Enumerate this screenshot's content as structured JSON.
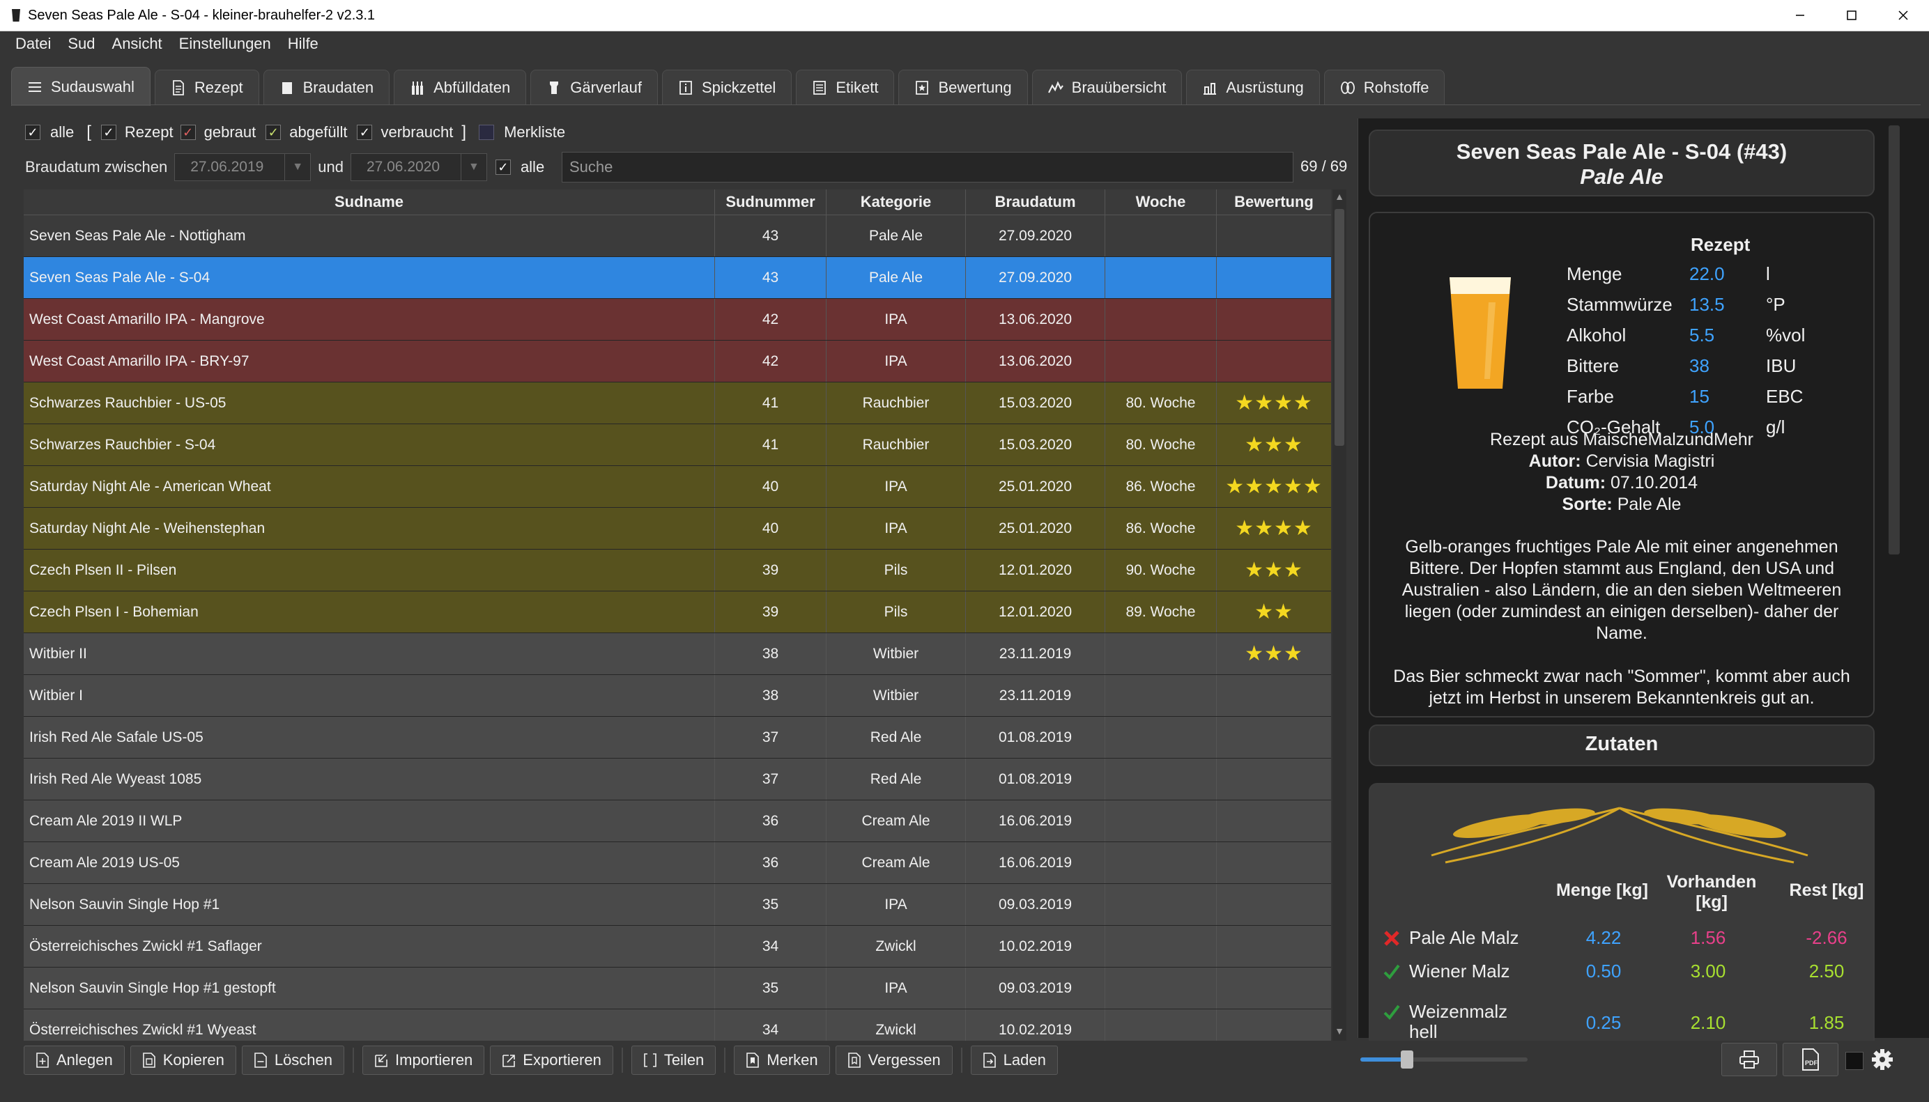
{
  "window": {
    "title": "Seven Seas Pale Ale - S-04 - kleiner-brauhelfer-2 v2.3.1"
  },
  "menu": [
    "Datei",
    "Sud",
    "Ansicht",
    "Einstellungen",
    "Hilfe"
  ],
  "tabs": [
    {
      "label": "Sudauswahl",
      "icon": "list-icon",
      "active": true
    },
    {
      "label": "Rezept",
      "icon": "document-icon"
    },
    {
      "label": "Braudaten",
      "icon": "kettle-icon"
    },
    {
      "label": "Abfülldaten",
      "icon": "bottles-icon"
    },
    {
      "label": "Gärverlauf",
      "icon": "fermenter-icon"
    },
    {
      "label": "Spickzettel",
      "icon": "info-icon"
    },
    {
      "label": "Etikett",
      "icon": "label-icon"
    },
    {
      "label": "Bewertung",
      "icon": "rating-icon"
    },
    {
      "label": "Brauübersicht",
      "icon": "chart-icon"
    },
    {
      "label": "Ausrüstung",
      "icon": "equipment-icon"
    },
    {
      "label": "Rohstoffe",
      "icon": "hops-icon"
    }
  ],
  "filters": {
    "alle": "alle",
    "open_bracket": "[",
    "rezept": "Rezept",
    "gebraut": "gebraut",
    "abgefuellt": "abgefüllt",
    "verbraucht": "verbraucht",
    "close_bracket": "]",
    "merkliste": "Merkliste",
    "braudatum_label": "Braudatum zwischen",
    "date_from": "27.06.2019",
    "und": "und",
    "date_to": "27.06.2020",
    "alle2": "alle",
    "search_placeholder": "Suche",
    "count": "69 / 69"
  },
  "table": {
    "headers": [
      "Sudname",
      "Sudnummer",
      "Kategorie",
      "Braudatum",
      "Woche",
      "Bewertung"
    ],
    "rows": [
      {
        "name": "Seven Seas Pale Ale - Nottigham",
        "nr": "43",
        "kat": "Pale Ale",
        "datum": "27.09.2020",
        "woche": "",
        "stars": 0,
        "status": "dark"
      },
      {
        "name": "Seven Seas Pale Ale - S-04",
        "nr": "43",
        "kat": "Pale Ale",
        "datum": "27.09.2020",
        "woche": "",
        "stars": 0,
        "status": "sel"
      },
      {
        "name": "West Coast Amarillo IPA - Mangrove",
        "nr": "42",
        "kat": "IPA",
        "datum": "13.06.2020",
        "woche": "",
        "stars": 0,
        "status": "red"
      },
      {
        "name": "West Coast Amarillo IPA - BRY-97",
        "nr": "42",
        "kat": "IPA",
        "datum": "13.06.2020",
        "woche": "",
        "stars": 0,
        "status": "red"
      },
      {
        "name": "Schwarzes Rauchbier - US-05",
        "nr": "41",
        "kat": "Rauchbier",
        "datum": "15.03.2020",
        "woche": "80. Woche",
        "stars": 4,
        "status": "olive"
      },
      {
        "name": "Schwarzes Rauchbier - S-04",
        "nr": "41",
        "kat": "Rauchbier",
        "datum": "15.03.2020",
        "woche": "80. Woche",
        "stars": 3,
        "status": "olive"
      },
      {
        "name": "Saturday Night Ale - American Wheat",
        "nr": "40",
        "kat": "IPA",
        "datum": "25.01.2020",
        "woche": "86. Woche",
        "stars": 5,
        "status": "olive"
      },
      {
        "name": "Saturday Night Ale - Weihenstephan",
        "nr": "40",
        "kat": "IPA",
        "datum": "25.01.2020",
        "woche": "86. Woche",
        "stars": 4,
        "status": "olive"
      },
      {
        "name": "Czech Plsen  II - Pilsen",
        "nr": "39",
        "kat": "Pils",
        "datum": "12.01.2020",
        "woche": "90. Woche",
        "stars": 3,
        "status": "olive"
      },
      {
        "name": "Czech Plsen I - Bohemian",
        "nr": "39",
        "kat": "Pils",
        "datum": "12.01.2020",
        "woche": "89. Woche",
        "stars": 2,
        "status": "olive"
      },
      {
        "name": "Witbier II",
        "nr": "38",
        "kat": "Witbier",
        "datum": "23.11.2019",
        "woche": "",
        "stars": 3,
        "status": "grey"
      },
      {
        "name": "Witbier I",
        "nr": "38",
        "kat": "Witbier",
        "datum": "23.11.2019",
        "woche": "",
        "stars": 0,
        "status": "grey"
      },
      {
        "name": "Irish Red Ale Safale US-05",
        "nr": "37",
        "kat": "Red Ale",
        "datum": "01.08.2019",
        "woche": "",
        "stars": 0,
        "status": "grey"
      },
      {
        "name": "Irish Red Ale Wyeast 1085",
        "nr": "37",
        "kat": "Red Ale",
        "datum": "01.08.2019",
        "woche": "",
        "stars": 0,
        "status": "grey"
      },
      {
        "name": "Cream Ale 2019 II WLP",
        "nr": "36",
        "kat": "Cream Ale",
        "datum": "16.06.2019",
        "woche": "",
        "stars": 0,
        "status": "grey"
      },
      {
        "name": "Cream Ale 2019 US-05",
        "nr": "36",
        "kat": "Cream Ale",
        "datum": "16.06.2019",
        "woche": "",
        "stars": 0,
        "status": "grey"
      },
      {
        "name": "Nelson Sauvin Single Hop #1",
        "nr": "35",
        "kat": "IPA",
        "datum": "09.03.2019",
        "woche": "",
        "stars": 0,
        "status": "grey"
      },
      {
        "name": "Österreichisches Zwickl #1 Saflager",
        "nr": "34",
        "kat": "Zwickl",
        "datum": "10.02.2019",
        "woche": "",
        "stars": 0,
        "status": "grey"
      },
      {
        "name": "Nelson Sauvin Single Hop #1 gestopft",
        "nr": "35",
        "kat": "IPA",
        "datum": "09.03.2019",
        "woche": "",
        "stars": 0,
        "status": "grey"
      },
      {
        "name": "Österreichisches Zwickl #1 Wyeast",
        "nr": "34",
        "kat": "Zwickl",
        "datum": "10.02.2019",
        "woche": "",
        "stars": 0,
        "status": "grey"
      }
    ]
  },
  "buttons": [
    "Anlegen",
    "Kopieren",
    "Löschen",
    "Importieren",
    "Exportieren",
    "Teilen",
    "Merken",
    "Vergessen",
    "Laden"
  ],
  "detail": {
    "title": "Seven Seas Pale Ale - S-04 (#43)",
    "subtitle": "Pale Ale",
    "rezept_header": "Rezept",
    "values": [
      {
        "label": "Menge",
        "value": "22.0",
        "unit": "l"
      },
      {
        "label": "Stammwürze",
        "value": "13.5",
        "unit": "°P"
      },
      {
        "label": "Alkohol",
        "value": "5.5",
        "unit": "%vol"
      },
      {
        "label": "Bittere",
        "value": "38",
        "unit": "IBU"
      },
      {
        "label": "Farbe",
        "value": "15",
        "unit": "EBC"
      },
      {
        "label": "CO₂-Gehalt",
        "value": "5.0",
        "unit": "g/l"
      }
    ],
    "source": "Rezept aus MaischeMalzundMehr",
    "autor_label": "Autor:",
    "autor": "Cervisia Magistri",
    "datum_label": "Datum:",
    "datum": "07.10.2014",
    "sorte_label": "Sorte:",
    "sorte": "Pale Ale",
    "desc1": "Gelb-oranges fruchtiges Pale Ale mit einer angenehmen Bittere. Der Hopfen stammt aus England, den USA und Australien - also Ländern, die an den sieben Weltmeeren liegen (oder zumindest an einigen derselben)- daher der Name.",
    "desc2": "Das Bier schmeckt zwar nach \"Sommer\", kommt aber auch jetzt im Herbst in unserem Bekanntenkreis gut an.",
    "zutaten_title": "Zutaten",
    "z_headers": {
      "menge": "Menge [kg]",
      "vorhanden": "Vorhanden [kg]",
      "rest": "Rest [kg]"
    },
    "zutaten": [
      {
        "name": "Pale Ale Malz",
        "menge": "4.22",
        "vorhanden": "1.56",
        "rest": "-2.66",
        "ok": false
      },
      {
        "name": "Wiener Malz",
        "menge": "0.50",
        "vorhanden": "3.00",
        "rest": "2.50",
        "ok": true
      },
      {
        "name": "Weizenmalz hell",
        "menge": "0.25",
        "vorhanden": "2.10",
        "rest": "1.85",
        "ok": true
      }
    ]
  },
  "colors": {
    "selected": "#2f86e0",
    "brewing_red": "#6a3232",
    "bottled_olive": "#57521e",
    "value_blue": "#3fa3ff",
    "negative_pink": "#e8408a",
    "positive_green": "#a8e030"
  }
}
